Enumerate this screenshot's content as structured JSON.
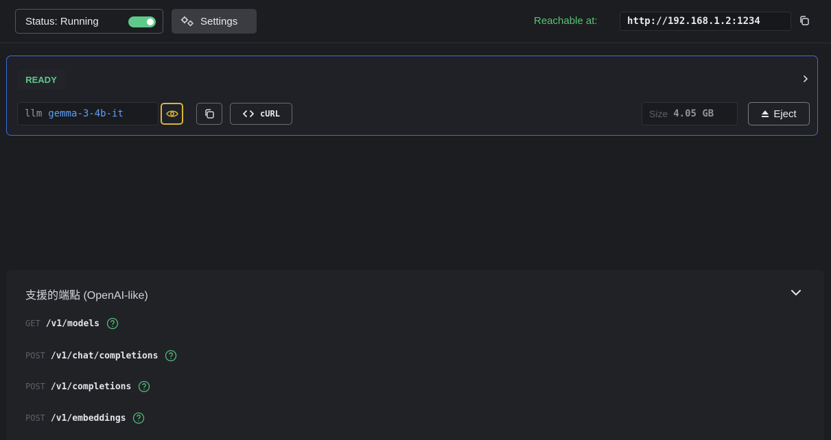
{
  "topbar": {
    "status_label": "Status: Running",
    "status_toggle_on": true,
    "settings_label": "Settings",
    "reachable_label": "Reachable at:",
    "reachable_url": "http://192.168.1.2:1234"
  },
  "model_card": {
    "state": "READY",
    "model_type": "llm",
    "model_id": "gemma-3-4b-it",
    "curl_label": "cURL",
    "size_label": "Size",
    "size_value": "4.05 GB",
    "eject_label": "Eject"
  },
  "endpoints": {
    "title": "支援的端點 (OpenAI-like)",
    "items": [
      {
        "method": "GET",
        "path": "/v1/models"
      },
      {
        "method": "POST",
        "path": "/v1/chat/completions"
      },
      {
        "method": "POST",
        "path": "/v1/completions"
      },
      {
        "method": "POST",
        "path": "/v1/embeddings"
      }
    ]
  },
  "colors": {
    "accent_blue": "#3b6be0",
    "ready_green": "#5fc98a",
    "reachable_green": "#57c472",
    "eye_highlight": "#d9b53c"
  },
  "icons": [
    "gears-icon",
    "copy-icon",
    "chevron-right-icon",
    "eye-icon",
    "code-icon",
    "eject-icon",
    "chevron-down-icon",
    "help-icon"
  ]
}
